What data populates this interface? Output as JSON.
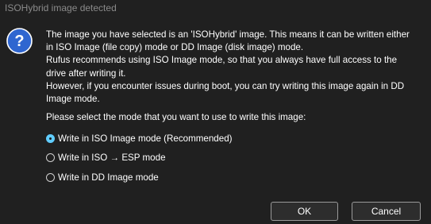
{
  "dialog": {
    "title": "ISOHybrid image detected",
    "icon": "question-icon",
    "message_lines": [
      "The image you have selected is an 'ISOHybrid' image. This means it can be written either",
      "in ISO Image (file copy) mode or DD Image (disk image) mode.",
      "Rufus recommends using ISO Image mode, so that you always have full access to the",
      "drive after writing it.",
      "However, if you encounter issues during boot, you can try writing this image again in DD",
      "Image mode."
    ],
    "prompt": "Please select the mode that you want to use to write this image:",
    "options": [
      {
        "label": "Write in ISO Image mode (Recommended)",
        "selected": true
      },
      {
        "label": "Write in ISO → ESP mode",
        "selected": false
      },
      {
        "label": "Write in DD Image mode",
        "selected": false
      }
    ],
    "ok_label": "OK",
    "cancel_label": "Cancel"
  },
  "colors": {
    "background": "#202020",
    "accent": "#60cdff",
    "icon_blue": "#2f66d0",
    "title_text": "#8a8a8a"
  }
}
